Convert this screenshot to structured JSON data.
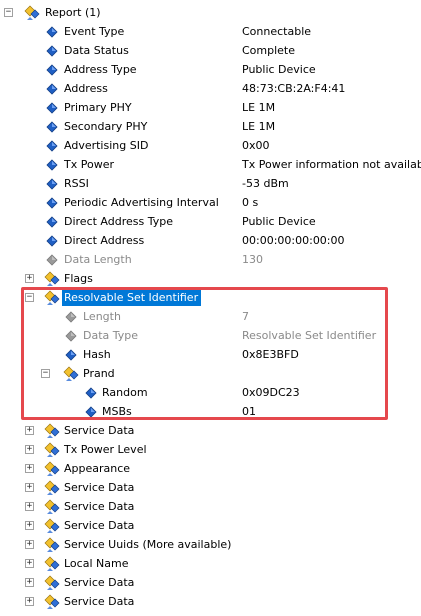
{
  "tree": {
    "rows": [
      {
        "name": "Report (1)",
        "value": "",
        "level": 0,
        "type": "node",
        "expander": "minus"
      },
      {
        "name": "Event Type",
        "value": "Connectable",
        "level": 1,
        "type": "leaf"
      },
      {
        "name": "Data Status",
        "value": "Complete",
        "level": 1,
        "type": "leaf"
      },
      {
        "name": "Address Type",
        "value": "Public Device",
        "level": 1,
        "type": "leaf"
      },
      {
        "name": "Address",
        "value": "48:73:CB:2A:F4:41",
        "level": 1,
        "type": "leaf"
      },
      {
        "name": "Primary PHY",
        "value": "LE 1M",
        "level": 1,
        "type": "leaf"
      },
      {
        "name": "Secondary PHY",
        "value": "LE 1M",
        "level": 1,
        "type": "leaf"
      },
      {
        "name": "Advertising SID",
        "value": "0x00",
        "level": 1,
        "type": "leaf"
      },
      {
        "name": "Tx Power",
        "value": "Tx Power information not available",
        "level": 1,
        "type": "leaf"
      },
      {
        "name": "RSSI",
        "value": "-53 dBm",
        "level": 1,
        "type": "leaf"
      },
      {
        "name": "Periodic Advertising Interval",
        "value": "0 s",
        "level": 1,
        "type": "leaf"
      },
      {
        "name": "Direct Address Type",
        "value": "Public Device",
        "level": 1,
        "type": "leaf"
      },
      {
        "name": "Direct Address",
        "value": "00:00:00:00:00:00",
        "level": 1,
        "type": "leaf"
      },
      {
        "name": "Data Length",
        "value": "130",
        "level": 1,
        "type": "leaf",
        "dim": true
      },
      {
        "name": "Flags",
        "value": "",
        "level": 1,
        "type": "node",
        "expander": "plus"
      },
      {
        "name": "Resolvable Set Identifier",
        "value": "",
        "level": 1,
        "type": "node",
        "expander": "minus",
        "selected": true
      },
      {
        "name": "Length",
        "value": "7",
        "level": 2,
        "type": "leaf",
        "dim": true
      },
      {
        "name": "Data Type",
        "value": "Resolvable Set Identifier",
        "level": 2,
        "type": "leaf",
        "dim": true
      },
      {
        "name": "Hash",
        "value": "0x8E3BFD",
        "level": 2,
        "type": "leaf"
      },
      {
        "name": "Prand",
        "value": "",
        "level": 2,
        "type": "node",
        "expander": "minus"
      },
      {
        "name": "Random",
        "value": "0x09DC23",
        "level": 3,
        "type": "leaf"
      },
      {
        "name": "MSBs",
        "value": "01",
        "level": 3,
        "type": "leaf"
      },
      {
        "name": "Service Data",
        "value": "",
        "level": 1,
        "type": "node",
        "expander": "plus"
      },
      {
        "name": "Tx Power Level",
        "value": "",
        "level": 1,
        "type": "node",
        "expander": "plus"
      },
      {
        "name": "Appearance",
        "value": "",
        "level": 1,
        "type": "node",
        "expander": "plus"
      },
      {
        "name": "Service Data",
        "value": "",
        "level": 1,
        "type": "node",
        "expander": "plus"
      },
      {
        "name": "Service Data",
        "value": "",
        "level": 1,
        "type": "node",
        "expander": "plus"
      },
      {
        "name": "Service Data",
        "value": "",
        "level": 1,
        "type": "node",
        "expander": "plus"
      },
      {
        "name": "Service Uuids (More available)",
        "value": "",
        "level": 1,
        "type": "node",
        "expander": "plus"
      },
      {
        "name": "Local Name",
        "value": "",
        "level": 1,
        "type": "node",
        "expander": "plus"
      },
      {
        "name": "Service Data",
        "value": "",
        "level": 1,
        "type": "node",
        "expander": "plus"
      },
      {
        "name": "Service Data",
        "value": "",
        "level": 1,
        "type": "node",
        "expander": "plus"
      }
    ]
  },
  "colors": {
    "selection": "#0078d7",
    "highlight_border": "#e5484d",
    "leaf_icon": "#1f5fc4",
    "leaf_icon_dim": "#9a9a9a",
    "node_icon_yellow": "#f2c12e",
    "node_icon_blue": "#2f6fd6"
  },
  "icons": {
    "leaf": "blue-diamond-icon",
    "node": "properties-folder-icon",
    "expand": "plus-box-icon",
    "collapse": "minus-box-icon"
  }
}
